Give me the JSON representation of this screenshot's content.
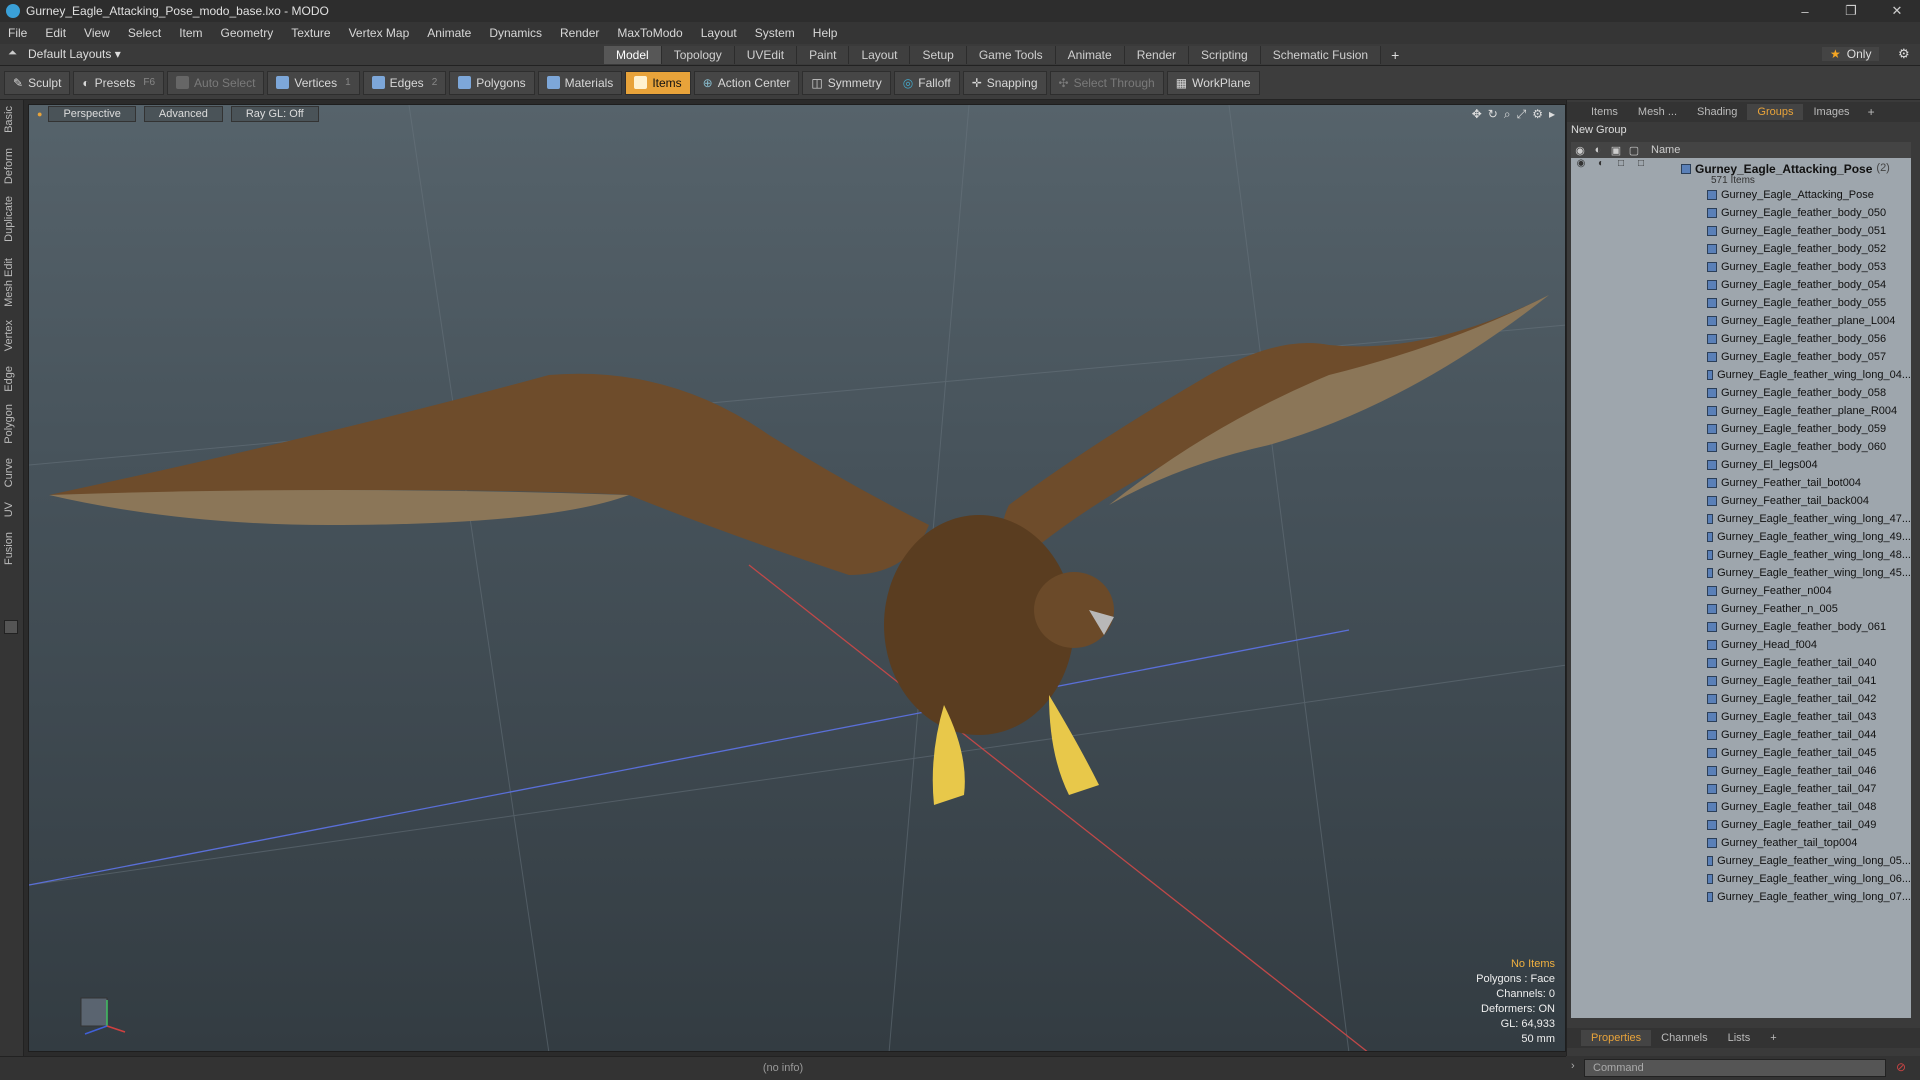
{
  "window": {
    "title": "Gurney_Eagle_Attacking_Pose_modo_base.lxo - MODO",
    "controls": [
      "–",
      "❐",
      "✕"
    ]
  },
  "menu": [
    "File",
    "Edit",
    "View",
    "Select",
    "Item",
    "Geometry",
    "Texture",
    "Vertex Map",
    "Animate",
    "Dynamics",
    "Render",
    "MaxToModo",
    "Layout",
    "System",
    "Help"
  ],
  "layout_selector": "Default Layouts ▾",
  "mode_tabs": [
    {
      "label": "Model",
      "active": true
    },
    {
      "label": "Topology",
      "active": false
    },
    {
      "label": "UVEdit",
      "active": false
    },
    {
      "label": "Paint",
      "active": false
    },
    {
      "label": "Layout",
      "active": false
    },
    {
      "label": "Setup",
      "active": false
    },
    {
      "label": "Game Tools",
      "active": false
    },
    {
      "label": "Animate",
      "active": false
    },
    {
      "label": "Render",
      "active": false
    },
    {
      "label": "Scripting",
      "active": false
    },
    {
      "label": "Schematic Fusion",
      "active": false
    }
  ],
  "only_label": "Only",
  "toolbar": {
    "sculpt": "Sculpt",
    "presets": "Presets",
    "presets_key": "F6",
    "auto_select": "Auto Select",
    "vertices": "Vertices",
    "vertices_count": "1",
    "edges": "Edges",
    "edges_count": "2",
    "polygons": "Polygons",
    "materials": "Materials",
    "items": "Items",
    "action_center": "Action Center",
    "symmetry": "Symmetry",
    "falloff": "Falloff",
    "snapping": "Snapping",
    "select_through": "Select Through",
    "workplane": "WorkPlane"
  },
  "left_tabs": [
    "Basic",
    "Deform",
    "Duplicate",
    "Mesh Edit",
    "Vertex",
    "Edge",
    "Polygon",
    "Curve",
    "UV",
    "Fusion"
  ],
  "viewport": {
    "view": "Perspective",
    "shading": "Advanced",
    "raygl": "Ray GL: Off",
    "info": {
      "no_items": "No Items",
      "polygons": "Polygons : Face",
      "channels": "Channels: 0",
      "deformers": "Deformers: ON",
      "gl": "GL: 64,933",
      "focal": "50 mm"
    }
  },
  "right_panel": {
    "tabs": [
      {
        "label": "Items",
        "active": false
      },
      {
        "label": "Mesh ...",
        "active": false
      },
      {
        "label": "Shading",
        "active": false
      },
      {
        "label": "Groups",
        "active": true
      },
      {
        "label": "Images",
        "active": false
      }
    ],
    "new_group": "New Group",
    "column_name": "Name",
    "group": {
      "name": "Gurney_Eagle_Attacking_Pose",
      "count": "(2)",
      "sub": "571 Items"
    },
    "items": [
      "Gurney_Eagle_Attacking_Pose",
      "Gurney_Eagle_feather_body_050",
      "Gurney_Eagle_feather_body_051",
      "Gurney_Eagle_feather_body_052",
      "Gurney_Eagle_feather_body_053",
      "Gurney_Eagle_feather_body_054",
      "Gurney_Eagle_feather_body_055",
      "Gurney_Eagle_feather_plane_L004",
      "Gurney_Eagle_feather_body_056",
      "Gurney_Eagle_feather_body_057",
      "Gurney_Eagle_feather_wing_long_04...",
      "Gurney_Eagle_feather_body_058",
      "Gurney_Eagle_feather_plane_R004",
      "Gurney_Eagle_feather_body_059",
      "Gurney_Eagle_feather_body_060",
      "Gurney_El_legs004",
      "Gurney_Feather_tail_bot004",
      "Gurney_Feather_tail_back004",
      "Gurney_Eagle_feather_wing_long_47...",
      "Gurney_Eagle_feather_wing_long_49...",
      "Gurney_Eagle_feather_wing_long_48...",
      "Gurney_Eagle_feather_wing_long_45...",
      "Gurney_Feather_n004",
      "Gurney_Feather_n_005",
      "Gurney_Eagle_feather_body_061",
      "Gurney_Head_f004",
      "Gurney_Eagle_feather_tail_040",
      "Gurney_Eagle_feather_tail_041",
      "Gurney_Eagle_feather_tail_042",
      "Gurney_Eagle_feather_tail_043",
      "Gurney_Eagle_feather_tail_044",
      "Gurney_Eagle_feather_tail_045",
      "Gurney_Eagle_feather_tail_046",
      "Gurney_Eagle_feather_tail_047",
      "Gurney_Eagle_feather_tail_048",
      "Gurney_Eagle_feather_tail_049",
      "Gurney_feather_tail_top004",
      "Gurney_Eagle_feather_wing_long_05...",
      "Gurney_Eagle_feather_wing_long_06...",
      "Gurney_Eagle_feather_wing_long_07..."
    ],
    "bottom_tabs": [
      {
        "label": "Properties",
        "active": true
      },
      {
        "label": "Channels",
        "active": false
      },
      {
        "label": "Lists",
        "active": false
      }
    ]
  },
  "status_info": "(no info)",
  "command_placeholder": "Command",
  "colors": {
    "accent": "#e8a33a",
    "viewport_top": "#56636b",
    "viewport_bottom": "#333c42",
    "list_bg": "#9ea6ad"
  }
}
